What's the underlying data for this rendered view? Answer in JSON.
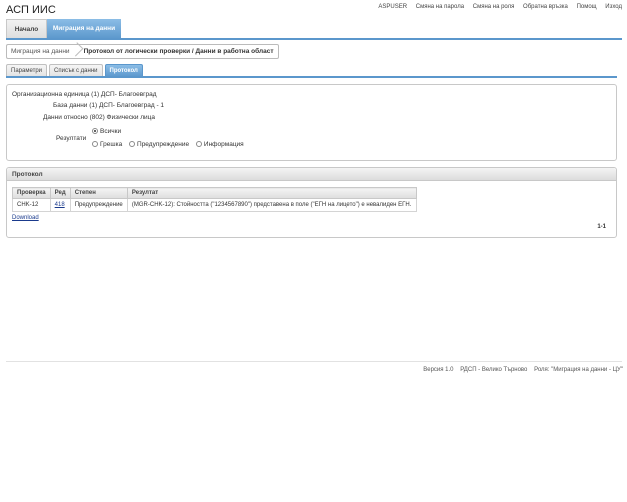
{
  "app": {
    "title": "АСП ИИС"
  },
  "top_links": [
    "ASPUSER",
    "Смяна на парола",
    "Смяна на роля",
    "Обратна връзка",
    "Помощ",
    "Изход"
  ],
  "main_nav": {
    "home": "Начало",
    "active": "Миграция на данни"
  },
  "breadcrumb": {
    "first": "Миграция на данни",
    "current": "Протокол от логически проверки / Данни в работна област"
  },
  "tabs": [
    {
      "label": "Параметри",
      "active": false
    },
    {
      "label": "Списък с данни",
      "active": false
    },
    {
      "label": "Протокол",
      "active": true
    }
  ],
  "params": {
    "org_label": "Организационна единица",
    "org_value": "(1) ДСП- Благоевград",
    "db_label": "База данни",
    "db_value": "(1) ДСП- Благоевград - 1",
    "data_label": "Данни относно",
    "data_value": "(802) Физически лица",
    "results_label": "Резултати",
    "options": [
      "Всички",
      "Грешка",
      "Предупреждение",
      "Информация"
    ],
    "selected": "Всички"
  },
  "protocol": {
    "title": "Протокол",
    "columns": [
      "Проверка",
      "Ред",
      "Степен",
      "Резултат"
    ],
    "rows": [
      {
        "check": "CHK-12",
        "row": "418",
        "level": "Предупреждение",
        "result": "(MGR-CHK-12): Стойността (\"1234567890\") представена в поле (\"ЕГН на лицето\") е невалиден ЕГН."
      }
    ],
    "download": "Download",
    "pager": "1-1"
  },
  "footer": {
    "version": "Версия 1.0",
    "unit": "РДСП - Велико Търново",
    "role": "Роля: \"Миграция на данни - ЦУ\""
  }
}
